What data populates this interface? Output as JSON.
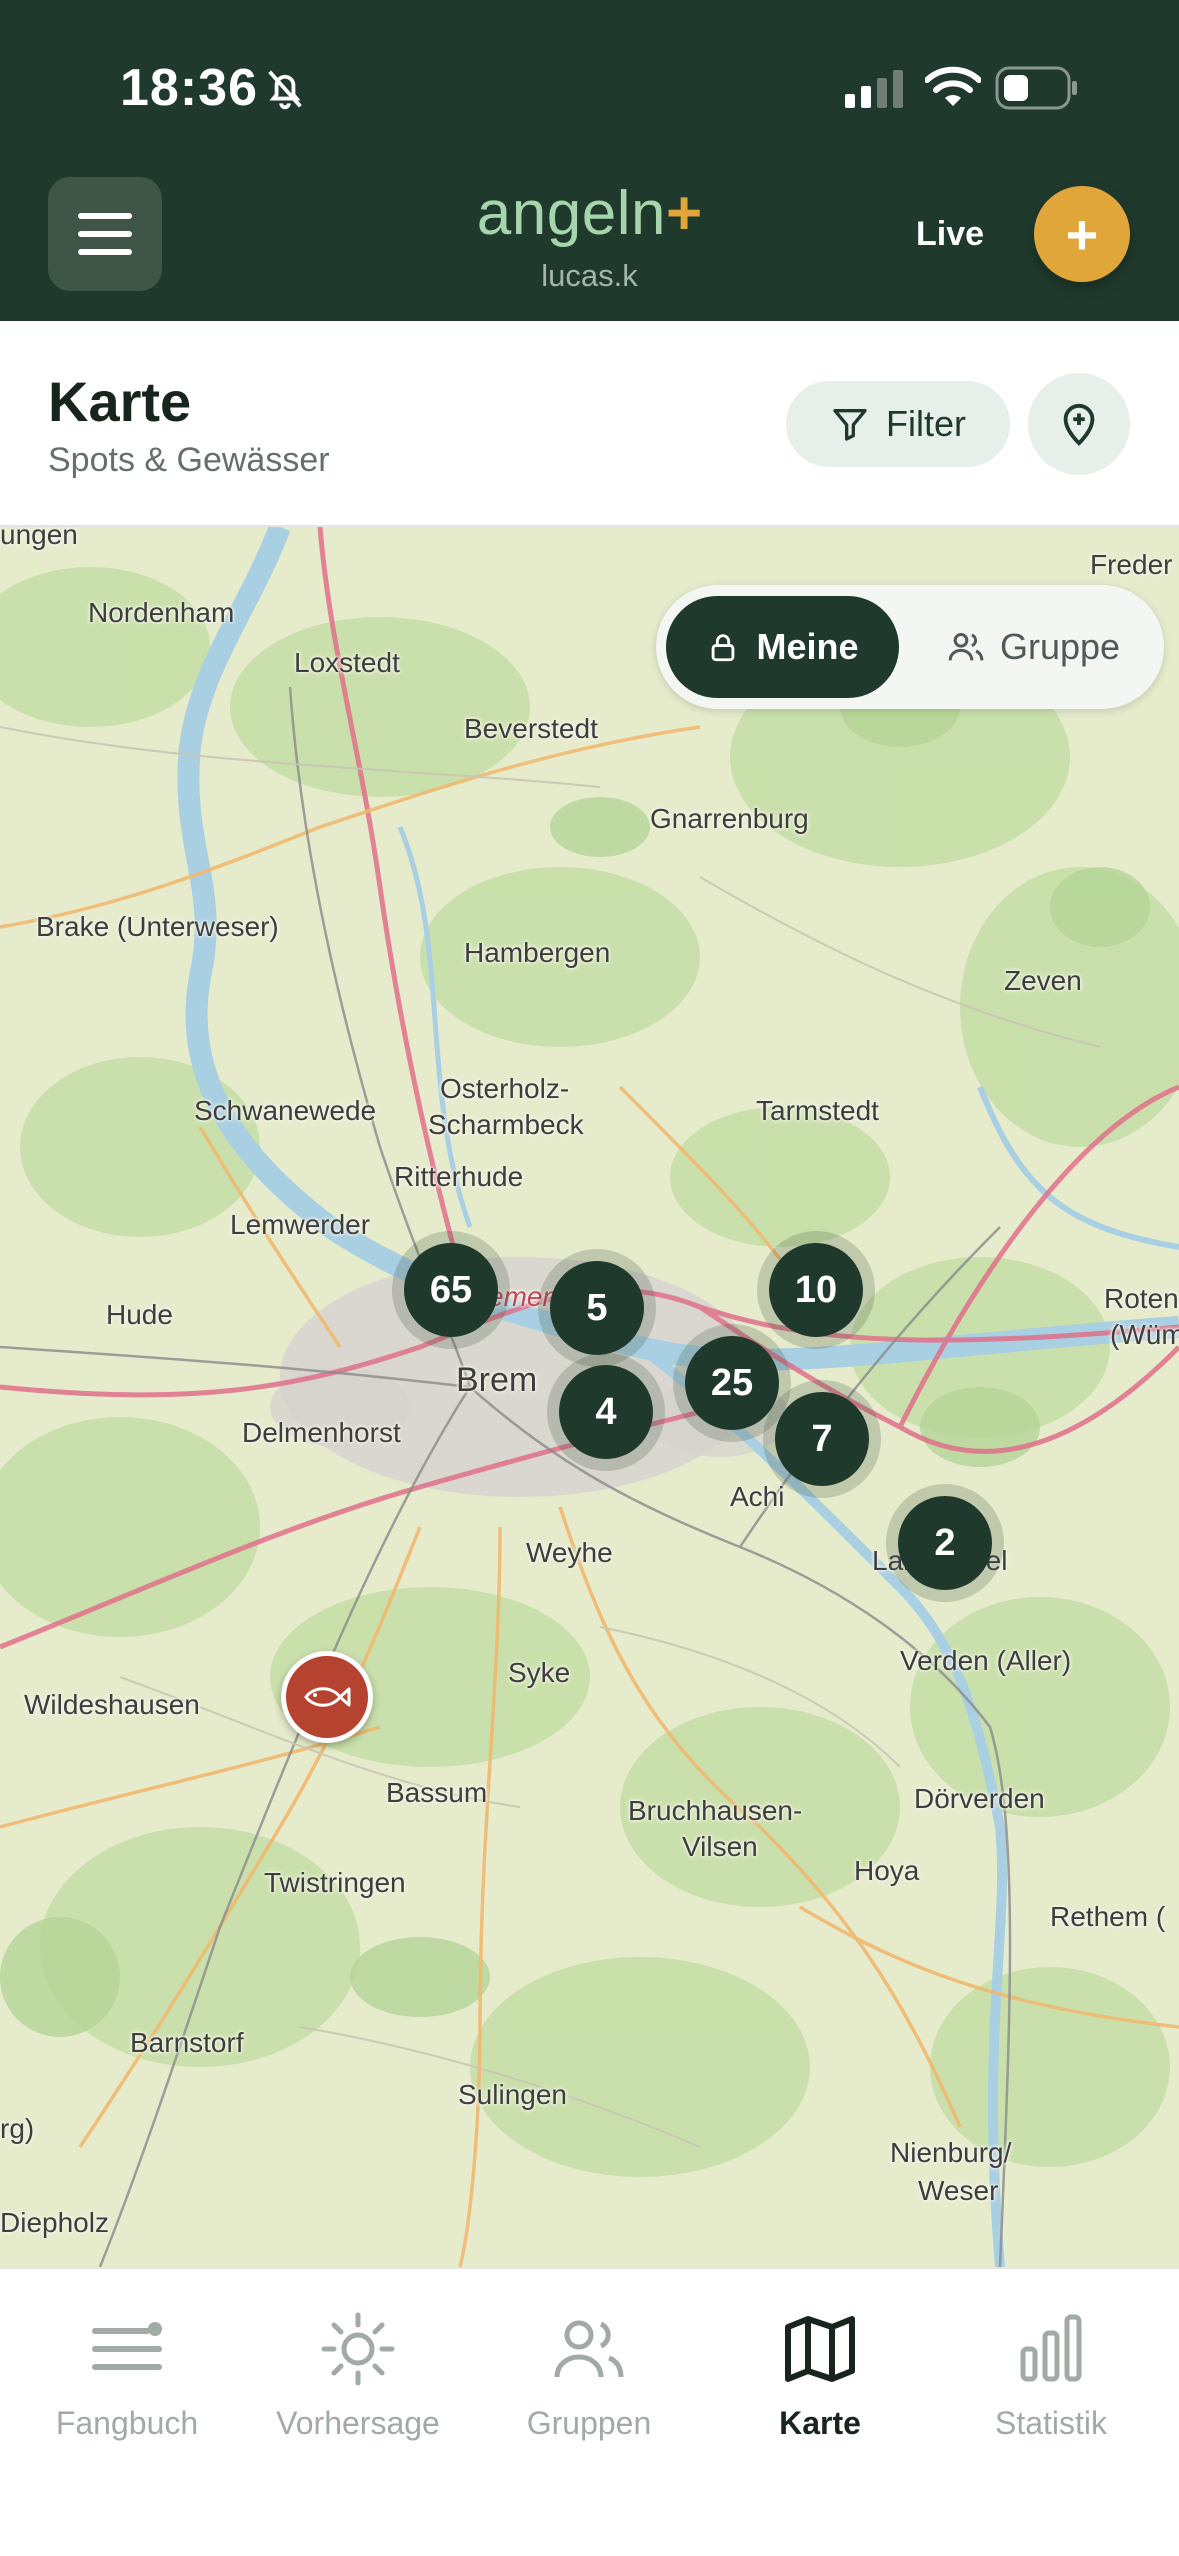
{
  "status_bar": {
    "time": "18:36",
    "icons": [
      "bell-muted-icon",
      "signal-icon",
      "wifi-icon",
      "battery-icon"
    ]
  },
  "header": {
    "brand": "angeln",
    "brand_suffix": "+",
    "user": "lucas.k",
    "live_label": "Live",
    "add_label": "+",
    "colors": {
      "background": "#1f3a2c",
      "brand": "#a6d4ac",
      "accent": "#e0a63a"
    }
  },
  "page": {
    "title": "Karte",
    "subtitle": "Spots & Gewässer",
    "filter_label": "Filter"
  },
  "map": {
    "toggle": {
      "mine_label": "Meine",
      "group_label": "Gruppe",
      "selected": "Meine"
    },
    "places": [
      "ungen",
      "Freder",
      "Nordenham",
      "Loxstedt",
      "Beverstedt",
      "Gnarrenburg",
      "Brake (Unterweser)",
      "Hambergen",
      "Zeven",
      "Osterholz-",
      "Scharmbeck",
      "Tarmstedt",
      "Schwanewede",
      "Ritterhude",
      "Lemwerder",
      "Bremen",
      "Brem",
      "Hude",
      "Roten",
      "(Wüm",
      "Delmenhorst",
      "Achi",
      "Langwedel",
      "Weyhe",
      "Verden (Aller)",
      "Syke",
      "Wildeshausen",
      "Bassum",
      "Bruchhausen-",
      "Vilsen",
      "Dörverden",
      "Twistringen",
      "Hoya",
      "Rethem (",
      "Barnstorf",
      "Sulingen",
      "rg)",
      "Nienburg/",
      "Weser",
      "Diepholz"
    ],
    "clusters": [
      "65",
      "5",
      "10",
      "25",
      "4",
      "7",
      "2"
    ],
    "marker": "fish-icon"
  },
  "bottom_nav": [
    {
      "label": "Fangbuch",
      "icon": "list-icon",
      "active": false
    },
    {
      "label": "Vorhersage",
      "icon": "sun-icon",
      "active": false
    },
    {
      "label": "Gruppen",
      "icon": "users-icon",
      "active": false
    },
    {
      "label": "Karte",
      "icon": "map-icon",
      "active": true
    },
    {
      "label": "Statistik",
      "icon": "bar-chart-icon",
      "active": false
    }
  ]
}
